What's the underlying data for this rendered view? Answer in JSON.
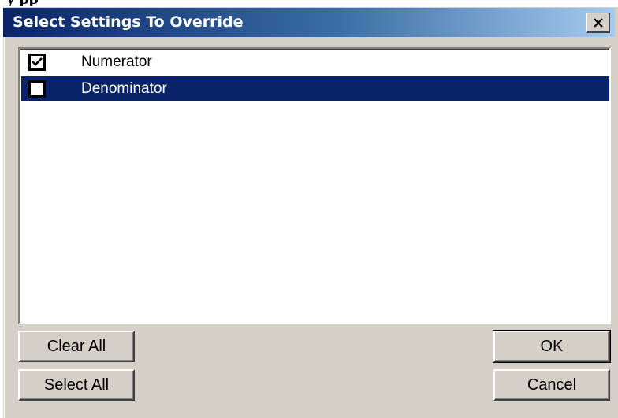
{
  "background": {
    "partial_text": "y        pp"
  },
  "dialog": {
    "title": "Select Settings To Override",
    "close_icon": "close-icon",
    "titlebar_colors": [
      "#0a246a",
      "#a6caf0"
    ],
    "selected_color": "#0a246a"
  },
  "list": {
    "items": [
      {
        "label": "Numerator",
        "checked": true,
        "selected": false
      },
      {
        "label": "Denominator",
        "checked": false,
        "selected": true
      }
    ]
  },
  "buttons": {
    "clear_all": "Clear All",
    "select_all": "Select All",
    "ok": "OK",
    "cancel": "Cancel"
  }
}
